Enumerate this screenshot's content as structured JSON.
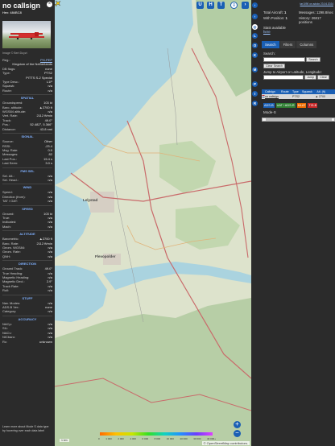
{
  "info": {
    "callsign": "no callsign",
    "hex_label": "Hex:",
    "hex": "484BC8",
    "photo_credit": "Image © Bert Duyzt",
    "rows_top": [
      {
        "k": "Reg.:",
        "v": "PH-PEP",
        "link": true
      },
      {
        "k": "",
        "v": "Kingdom of the Netherlands"
      },
      {
        "k": "DB flags:",
        "v": "none"
      },
      {
        "k": "Type:",
        "v": "PTS2"
      },
      {
        "k": "",
        "v": "PITTS S-2 Special"
      },
      {
        "k": "Type Desc.:",
        "v": "L1P"
      },
      {
        "k": "Squawk:",
        "v": "n/a"
      },
      {
        "k": "Route:",
        "v": "n/a"
      }
    ],
    "sections": [
      {
        "title": "SPATIAL",
        "rows": [
          {
            "k": "Groundspeed:",
            "v": "103 kt"
          },
          {
            "k": "Baro. altitude:",
            "v": "▲2700 ft"
          },
          {
            "k": "WGS84 altitude:",
            "v": "n/a"
          },
          {
            "k": "Vert. Rate:",
            "v": "2112 ft/min"
          },
          {
            "k": "Track:",
            "v": "49.0°"
          },
          {
            "k": "Pos.:",
            "v": "52.482°, 5.366°"
          },
          {
            "k": "Distance:",
            "v": "43.8 nmi"
          }
        ]
      },
      {
        "title": "SIGNAL",
        "rows": [
          {
            "k": "Source:",
            "v": "Other"
          },
          {
            "k": "RSSI:",
            "v": "-23.4"
          },
          {
            "k": "Msg. Rate:",
            "v": "0.0"
          },
          {
            "k": "Messages:",
            "v": "82"
          },
          {
            "k": "Last Pos.:",
            "v": "15.4 s"
          },
          {
            "k": "Last Seen:",
            "v": "3.0 s"
          }
        ]
      },
      {
        "title": "FMS SEL",
        "rows": [
          {
            "k": "Sel. Alt.:",
            "v": "n/a"
          },
          {
            "k": "Sel. Head.:",
            "v": "n/a"
          }
        ]
      },
      {
        "title": "WIND",
        "rows": [
          {
            "k": "Speed:",
            "v": "n/a"
          },
          {
            "k": "Direction (from):",
            "v": "n/a"
          },
          {
            "k": "TAT / OAT:",
            "v": "n/a"
          }
        ]
      },
      {
        "title": "SPEED",
        "rows": [
          {
            "k": "Ground:",
            "v": "103 kt"
          },
          {
            "k": "True:",
            "v": "n/a"
          },
          {
            "k": "Indicated:",
            "v": "n/a"
          },
          {
            "k": "Mach:",
            "v": "n/a"
          }
        ]
      },
      {
        "title": "ALTITUDE",
        "rows": [
          {
            "k": "Barometric:",
            "v": "▲2700 ft"
          },
          {
            "k": "Baro. Rate:",
            "v": "2112 ft/min"
          },
          {
            "k": "Geom. WGS84:",
            "v": "n/a"
          },
          {
            "k": "Geom. Rate:",
            "v": "n/a"
          },
          {
            "k": "QNH:",
            "v": "n/a"
          }
        ]
      },
      {
        "title": "DIRECTION",
        "rows": [
          {
            "k": "Ground Track:",
            "v": "49.0°"
          },
          {
            "k": "True Heading:",
            "v": "n/a"
          },
          {
            "k": "Magnetic Heading:",
            "v": "n/a"
          },
          {
            "k": "Magnetic Decl.:",
            "v": "2.9°"
          },
          {
            "k": "Track Rate:",
            "v": "n/a"
          },
          {
            "k": "Roll:",
            "v": "n/a"
          }
        ]
      },
      {
        "title": "STUFF",
        "rows": [
          {
            "k": "Nav. Modes:",
            "v": "n/a"
          },
          {
            "k": "ADS-B Ver.:",
            "v": "none"
          },
          {
            "k": "Category:",
            "v": "n/a"
          }
        ]
      },
      {
        "title": "ACCURACY",
        "rows": [
          {
            "k": "NACp:",
            "v": "n/a"
          },
          {
            "k": "SIL:",
            "v": "n/a"
          },
          {
            "k": "NACv:",
            "v": "n/a"
          },
          {
            "k": "NICbaro:",
            "v": "n/a"
          },
          {
            "k": "Rc:",
            "v": "unknown"
          }
        ]
      }
    ],
    "footer": "Learn more about Mode S data type by hovering over each data label"
  },
  "map": {
    "top_buttons": [
      "U",
      "H",
      "T"
    ],
    "places": [
      "Lelystad",
      "Flevopolder"
    ],
    "scale": "1 km",
    "alt_labels": [
      "0",
      "1 000",
      "2 000",
      "4 000",
      "6 000",
      "8 000",
      "10 000",
      "20 000",
      "30 000",
      "40 000+"
    ],
    "attribution": "© OpenStreetMap contributors.",
    "zoom_in": "+",
    "zoom_out": "−"
  },
  "sidebar": {
    "strip_buttons": [
      "L",
      "O",
      "K",
      "M",
      "P",
      "I",
      "R"
    ],
    "top_link": "tar1090 on adsbx 23.04.2024",
    "stats": {
      "total_aircraft_label": "Total Aircraft:",
      "total_aircraft": "1",
      "messages_label": "Messages:",
      "messages": "1298.8/sec",
      "with_position_label": "With Position:",
      "with_position": "1",
      "history_label": "History:",
      "history": "26817 positions",
      "stats_label": "Stats available",
      "stats_link": "here"
    },
    "tabs": [
      "Search",
      "Filters",
      "Columns"
    ],
    "search_label": "Search:",
    "search_button": "Search",
    "clear_search": "Clear Search",
    "jump_label": "Jump to Airport or Latitude, Longitude:",
    "jump_button": "Jump",
    "clear_button": "Clear",
    "table_headers": [
      "",
      "Callsign",
      "Route",
      "Type",
      "Squawk",
      "Alt. (ft)"
    ],
    "table_row": {
      "callsign": "no callsign",
      "route": "",
      "type": "PTS2",
      "squawk": "",
      "alt": "▲ 2700"
    },
    "badges": [
      "ADS-B",
      "UAT / ADS-R",
      "MLAT",
      "TIS-B"
    ],
    "modes_label": "Mode-S",
    "colors": {
      "adsb": "#1a5fb4",
      "uat": "#2e7d32",
      "mlat": "#ef6c00",
      "tisb": "#c62828"
    }
  }
}
